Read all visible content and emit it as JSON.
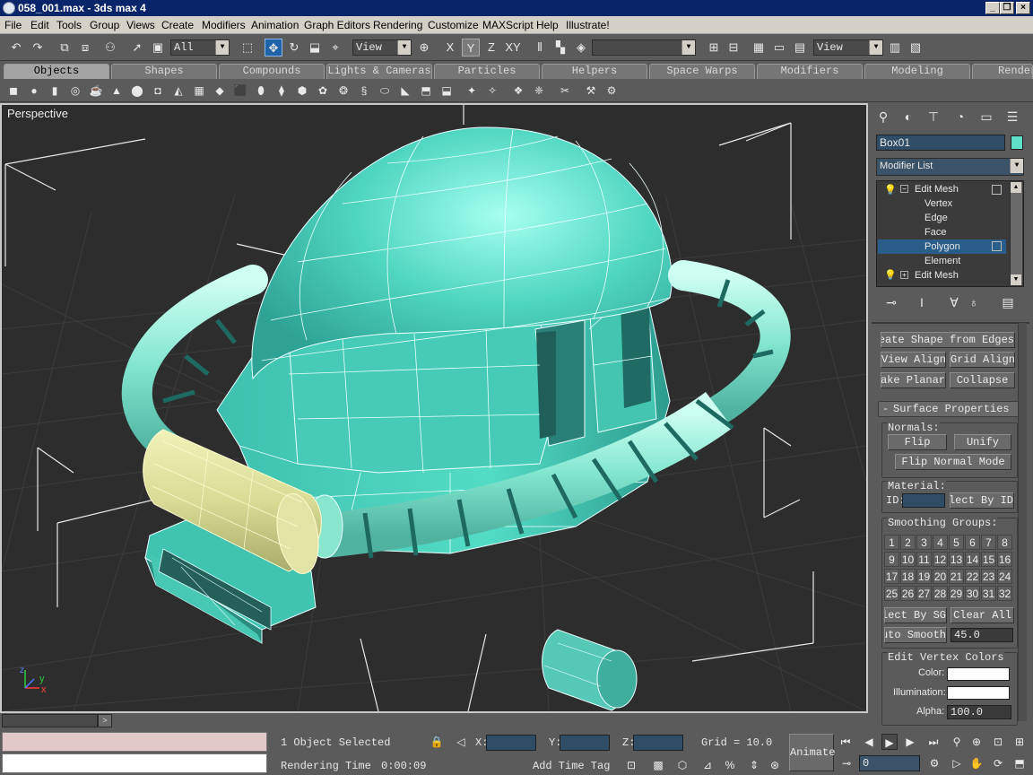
{
  "window": {
    "title": "058_001.max - 3ds max 4"
  },
  "menu": [
    "File",
    "Edit",
    "Tools",
    "Group",
    "Views",
    "Create",
    "Modifiers",
    "Animation",
    "Graph Editors",
    "Rendering",
    "Customize",
    "MAXScript",
    "Help",
    "Illustrate!"
  ],
  "toolbar": {
    "selection_filter": "All",
    "ref_coord_1": "View",
    "axis_x": "X",
    "axis_y": "Y",
    "axis_z": "Z",
    "axis_xy": "XY",
    "named_selection": "",
    "ref_coord_2": "View"
  },
  "tabs": [
    "Objects",
    "Shapes",
    "Compounds",
    "Lights & Cameras",
    "Particles",
    "Helpers",
    "Space Warps",
    "Modifiers",
    "Modeling",
    "Render"
  ],
  "viewport": {
    "label": "Perspective"
  },
  "command_panel": {
    "object_name": "Box01",
    "object_color": "#5fe0c8",
    "modifier_list_label": "Modifier List",
    "stack": [
      {
        "label": "Edit Mesh",
        "level": 0,
        "expanded": true
      },
      {
        "label": "Vertex",
        "level": 1
      },
      {
        "label": "Edge",
        "level": 1
      },
      {
        "label": "Face",
        "level": 1
      },
      {
        "label": "Polygon",
        "level": 1,
        "selected": true
      },
      {
        "label": "Element",
        "level": 1
      },
      {
        "label": "Edit Mesh",
        "level": 0,
        "expanded": false
      }
    ],
    "buttons": {
      "create_shape": "Create Shape from Edges",
      "view_align": "View Align",
      "grid_align": "Grid Align",
      "make_planar": "Make Planar",
      "collapse": "Collapse"
    },
    "surface": {
      "title": "Surface Properties",
      "normals_label": "Normals:",
      "flip": "Flip",
      "unify": "Unify",
      "flip_normal_mode": "Flip Normal Mode",
      "material_label": "Material:",
      "id_label": "ID:",
      "select_by_id": "Select By ID",
      "smoothing_label": "Smoothing Groups:",
      "groups": [
        "1",
        "2",
        "3",
        "4",
        "5",
        "6",
        "7",
        "8",
        "9",
        "10",
        "11",
        "12",
        "13",
        "14",
        "15",
        "16",
        "17",
        "18",
        "19",
        "20",
        "21",
        "22",
        "23",
        "24",
        "25",
        "26",
        "27",
        "28",
        "29",
        "30",
        "31",
        "32"
      ],
      "select_by_sg": "Select By SG",
      "clear_all": "Clear All",
      "auto_smooth": "Auto Smooth",
      "auto_smooth_value": "45.0",
      "vertex_colors_title": "Edit Vertex Colors",
      "color_label": "Color:",
      "illumination_label": "Illumination:",
      "alpha_label": "Alpha:",
      "alpha_value": "100.0"
    }
  },
  "status": {
    "selection": "1 Object Selected",
    "x_label": "X:",
    "y_label": "Y:",
    "z_label": "Z:",
    "grid": "Grid = 10.0",
    "rendering_time_label": "Rendering Time",
    "rendering_time": "0:00:09",
    "add_time_tag": "Add Time Tag",
    "animate": "Animate",
    "frame": "0"
  }
}
